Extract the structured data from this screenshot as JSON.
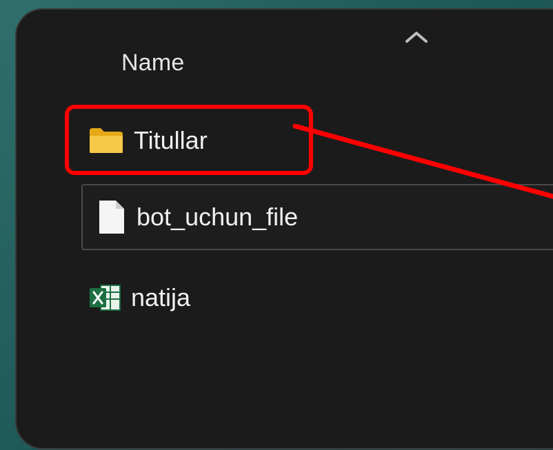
{
  "header": {
    "name_column_label": "Name",
    "sort_icon": "chevron-up-icon"
  },
  "files": [
    {
      "name": "Titullar",
      "icon": "folder-icon",
      "type": "folder",
      "highlighted": true
    },
    {
      "name": "bot_uchun_file",
      "icon": "document-icon",
      "type": "file",
      "selected": true
    },
    {
      "name": "natija",
      "icon": "excel-icon",
      "type": "spreadsheet"
    }
  ],
  "colors": {
    "window_background": "#1b1b1b",
    "highlight": "#ff0000",
    "folder": "#f4c542",
    "excel": "#1d6f42",
    "desktop": "#1f5a58"
  }
}
